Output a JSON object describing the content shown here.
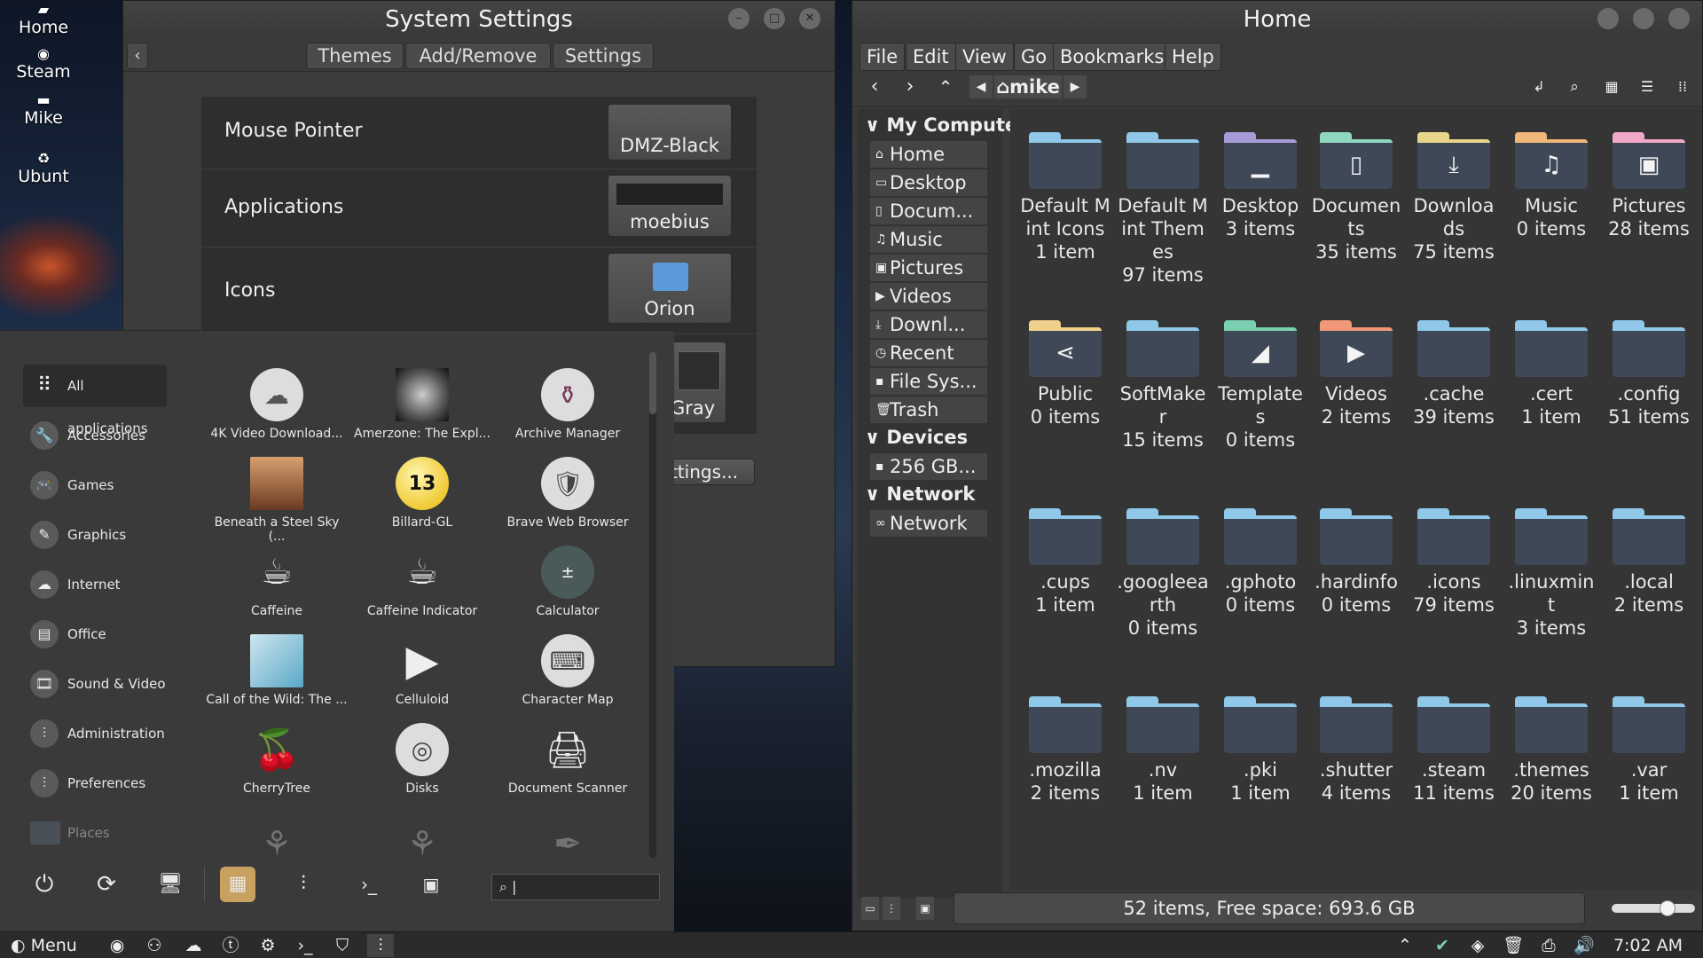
{
  "desktop": {
    "icons": [
      {
        "label": "Home"
      },
      {
        "label": "Steam"
      },
      {
        "label": "Mike"
      },
      {
        "label": "Ubunt"
      }
    ]
  },
  "settings": {
    "title": "System Settings",
    "tabs": [
      "Themes",
      "Add/Remove",
      "Settings"
    ],
    "rows": [
      {
        "label": "Mouse Pointer",
        "value": "DMZ-Black"
      },
      {
        "label": "Applications",
        "value": "moebius"
      },
      {
        "label": "Icons",
        "value": "Orion"
      }
    ],
    "partial_value": "Gray",
    "partial_button": "ttings..."
  },
  "menu": {
    "categories": [
      "All applications",
      "Accessories",
      "Games",
      "Graphics",
      "Internet",
      "Office",
      "Sound & Video",
      "Administration",
      "Preferences",
      "Places"
    ],
    "apps": [
      "4K Video Download...",
      "Amerzone: The Expl...",
      "Archive Manager",
      "Beneath a Steel Sky (...",
      "Billard-GL",
      "Brave Web Browser",
      "Caffeine",
      "Caffeine Indicator",
      "Calculator",
      "Call of the Wild: The ...",
      "Celluloid",
      "Character Map",
      "CherryTree",
      "Disks",
      "Document Scanner"
    ],
    "billard_number": "13",
    "search_value": "|"
  },
  "filemanager": {
    "title": "Home",
    "menubar": [
      "File",
      "Edit",
      "View",
      "Go",
      "Bookmarks",
      "Help"
    ],
    "path": "mike",
    "sidebar": {
      "my_computer": "My Compute",
      "places": [
        "Home",
        "Desktop",
        "Docum...",
        "Music",
        "Pictures",
        "Videos",
        "Downl...",
        "Recent",
        "File Sys...",
        "Trash"
      ],
      "devices_header": "Devices",
      "devices": [
        "256 GB..."
      ],
      "network_header": "Network",
      "network": [
        "Network"
      ]
    },
    "items": [
      {
        "name": "Default Mint Icons",
        "count": "1 item"
      },
      {
        "name": "Default Mint Themes",
        "count": "97 items"
      },
      {
        "name": "Desktop",
        "count": "3 items"
      },
      {
        "name": "Documents",
        "count": "35 items"
      },
      {
        "name": "Downloads",
        "count": "75 items"
      },
      {
        "name": "Music",
        "count": "0 items"
      },
      {
        "name": "Pictures",
        "count": "28 items"
      },
      {
        "name": "Public",
        "count": "0 items"
      },
      {
        "name": "SoftMaker",
        "count": "15 items"
      },
      {
        "name": "Templates",
        "count": "0 items"
      },
      {
        "name": "Videos",
        "count": "2 items"
      },
      {
        "name": ".cache",
        "count": "39 items"
      },
      {
        "name": ".cert",
        "count": "1 item"
      },
      {
        "name": ".config",
        "count": "51 items"
      },
      {
        "name": ".cups",
        "count": "1 item"
      },
      {
        "name": ".googleearth",
        "count": "0 items"
      },
      {
        "name": ".gphoto",
        "count": "0 items"
      },
      {
        "name": ".hardinfo",
        "count": "0 items"
      },
      {
        "name": ".icons",
        "count": "79 items"
      },
      {
        "name": ".linuxmint",
        "count": "3 items"
      },
      {
        "name": ".local",
        "count": "2 items"
      },
      {
        "name": ".mozilla",
        "count": "2 items"
      },
      {
        "name": ".nv",
        "count": "1 item"
      },
      {
        "name": ".pki",
        "count": "1 item"
      },
      {
        "name": ".shutter",
        "count": "4 items"
      },
      {
        "name": ".steam",
        "count": "11 items"
      },
      {
        "name": ".themes",
        "count": "20 items"
      },
      {
        "name": ".var",
        "count": "1 item"
      }
    ],
    "status": "52 items, Free space: 693.6 GB"
  },
  "taskbar": {
    "menu_label": "Menu",
    "clock": "7:02 AM"
  },
  "colors": {
    "folder_default": "#8fc8e8",
    "folder_desktop": "#a89cd8",
    "folder_documents": "#8fd8c0",
    "folder_downloads": "#e8d48a",
    "folder_music": "#f0b878",
    "folder_pictures": "#f0a8c8",
    "folder_public": "#f0d08a",
    "folder_templates": "#7ad0b0",
    "folder_videos": "#f09878"
  }
}
